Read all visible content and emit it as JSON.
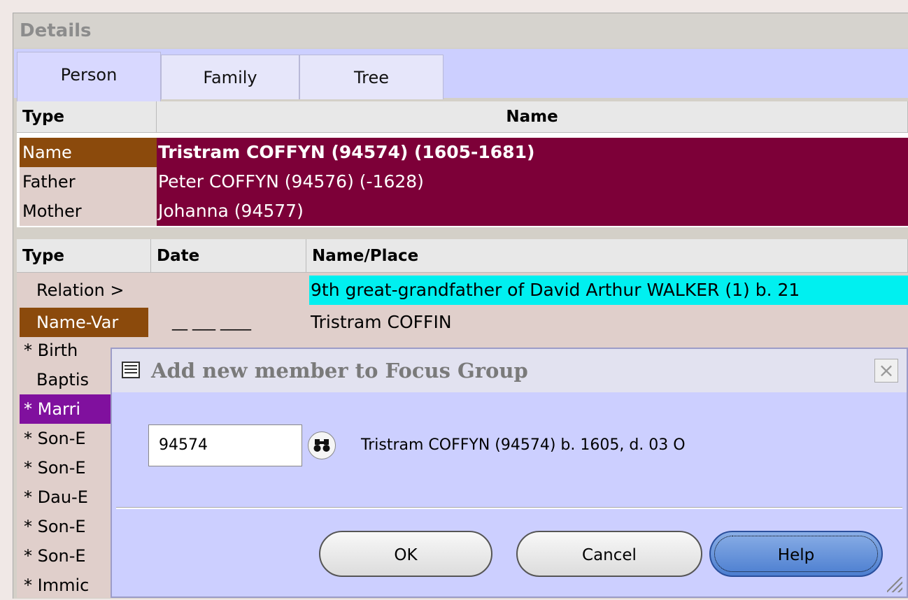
{
  "panel": {
    "title": "Details"
  },
  "tabs": [
    {
      "label": "Person",
      "active": true
    },
    {
      "label": "Family",
      "active": false
    },
    {
      "label": "Tree",
      "active": false
    }
  ],
  "person_grid": {
    "headers": {
      "type": "Type",
      "name": "Name"
    },
    "rows": [
      {
        "type": "Name",
        "value": "Tristram COFFYN (94574)  (1605-1681)",
        "selected": true
      },
      {
        "type": "Father",
        "value": "Peter COFFYN (94576)  (-1628)",
        "selected": false
      },
      {
        "type": "Mother",
        "value": "Johanna (94577)",
        "selected": false
      }
    ]
  },
  "events_grid": {
    "headers": {
      "type": "Type",
      "date": "Date",
      "place": "Name/Place"
    },
    "rows": [
      {
        "type": "Relation >",
        "date": "",
        "place": "9th great-grandfather of David Arthur WALKER (1) b. 21"
      },
      {
        "type": "Name-Var",
        "date": "__ ___ ____",
        "place": "Tristram COFFIN"
      },
      {
        "type": "* Birth",
        "date": "",
        "place": ""
      },
      {
        "type": "Baptis",
        "date": "",
        "place": ""
      },
      {
        "type": "* Marri",
        "date": "",
        "place": ""
      },
      {
        "type": "* Son-E",
        "date": "",
        "place": ""
      },
      {
        "type": "* Son-E",
        "date": "",
        "place": ""
      },
      {
        "type": "* Dau-E",
        "date": "",
        "place": ""
      },
      {
        "type": "* Son-E",
        "date": "",
        "place": ""
      },
      {
        "type": "* Son-E",
        "date": "",
        "place": ""
      },
      {
        "type": "* Immic",
        "date": "",
        "place": ""
      }
    ]
  },
  "dialog": {
    "title": "Add new member to Focus Group",
    "close_glyph": "×",
    "input_value": "94574",
    "result_text": "Tristram COFFYN (94574) b. 1605, d. 03 O",
    "buttons": {
      "ok": "OK",
      "cancel": "Cancel",
      "help": "Help"
    }
  },
  "colors": {
    "selected_row_bg": "#7d0038",
    "type_selected_bg": "#8b4a0c",
    "marriage_selected_bg": "#80109e",
    "relation_highlight": "#00f0f0",
    "tab_strip_bg": "#cccfff"
  }
}
